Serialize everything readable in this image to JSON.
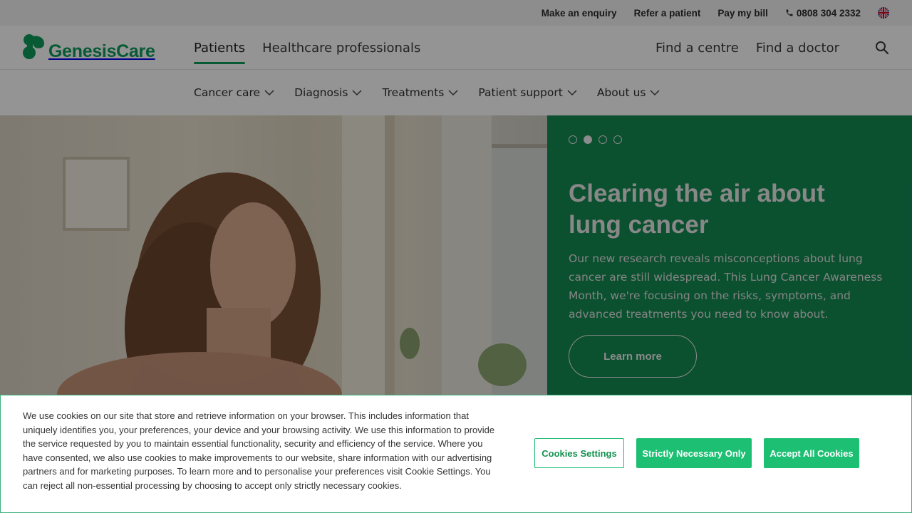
{
  "utility_bar": {
    "enquiry": "Make an enquiry",
    "refer": "Refer a patient",
    "pay_bill": "Pay my bill",
    "phone": "0808 304 2332",
    "language_icon": "uk-flag-icon"
  },
  "brand": {
    "name": "GenesisCare",
    "color": "#0e9c5a"
  },
  "primary_nav": {
    "patients": "Patients",
    "professionals": "Healthcare professionals",
    "find_centre": "Find a centre",
    "find_doctor": "Find a doctor",
    "search_icon": "search-icon"
  },
  "sub_nav": {
    "items": [
      "Cancer care",
      "Diagnosis",
      "Treatments",
      "Patient support",
      "About us"
    ]
  },
  "hero": {
    "title": "Clearing the air about lung cancer",
    "body": "Our new research reveals misconceptions about lung cancer are still widespread. This Lung Cancer Awareness Month, we're focusing on the risks, symptoms, and advanced treatments you need to know about.",
    "cta": "Learn more",
    "slides_total": 4,
    "active_slide": 2,
    "panel_color": "#138a52"
  },
  "cookie_banner": {
    "text": "We use cookies on our site that store and retrieve information on your browser. This includes information that uniquely identifies you, your preferences, your device and your browsing activity. We use this information to provide the service requested by you to maintain essential functionality, security and efficiency of the service. Where you have consented, we also use cookies to make improvements to our website, share information with our advertising partners and for marketing purposes. To learn more and to personalise your preferences visit Cookie Settings. You can reject all non-essential processing by choosing to accept only strictly necessary cookies.",
    "settings": "Cookies Settings",
    "strict": "Strictly Necessary Only",
    "accept": "Accept All Cookies",
    "accent": "#1dbf72"
  }
}
